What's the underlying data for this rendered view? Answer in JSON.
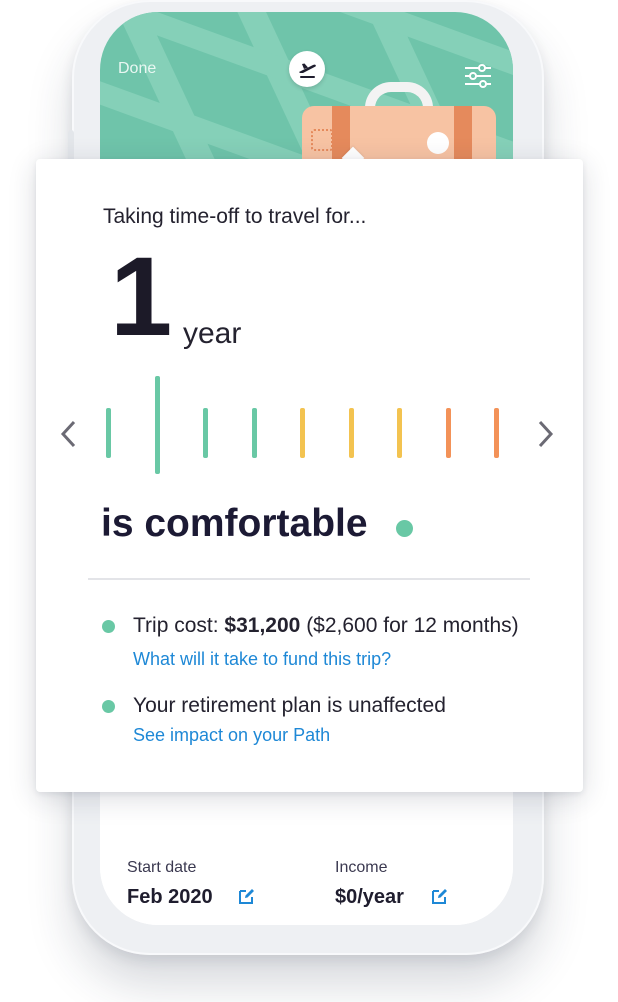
{
  "colors": {
    "green": "#69c8a5",
    "yellow": "#f3c350",
    "orange": "#f39258",
    "link": "#1e88d6",
    "map": "#6fc4aa"
  },
  "header": {
    "done_label": "Done",
    "trip_icon": "airplane-icon",
    "settings_icon": "sliders-icon"
  },
  "card": {
    "intro": "Taking time-off to travel for...",
    "duration_value": "1",
    "duration_unit": "year",
    "selector": {
      "selected_index": 1,
      "ticks": [
        "green",
        "green",
        "green",
        "green",
        "yellow",
        "yellow",
        "yellow",
        "orange",
        "orange"
      ]
    },
    "status": "is comfortable",
    "trip_cost_label": "Trip cost:",
    "trip_cost_value": "$31,200",
    "trip_cost_detail": "($2,600 for 12 months)",
    "fund_link": "What will it take to fund this trip?",
    "retirement_text": "Your retirement plan is unaffected",
    "path_link": "See impact on your Path"
  },
  "details": {
    "start_date_label": "Start date",
    "start_date_value": "Feb 2020",
    "income_label": "Income",
    "income_value": "$0/year"
  }
}
